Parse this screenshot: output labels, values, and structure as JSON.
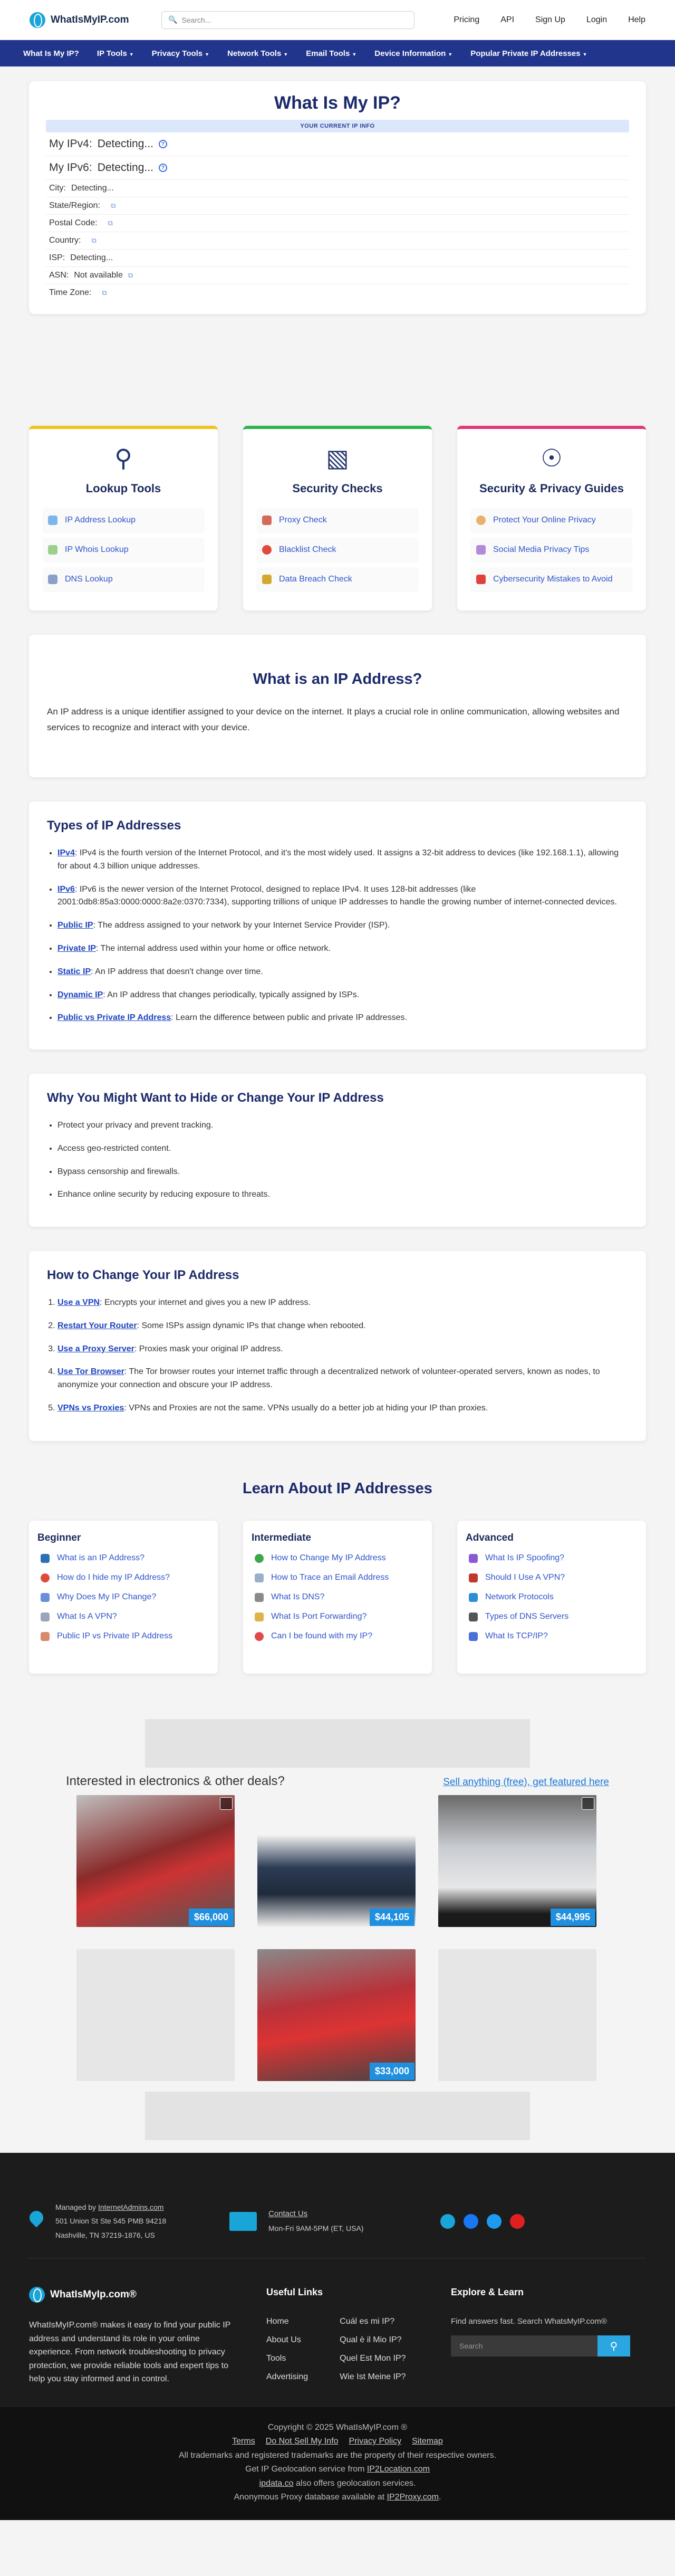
{
  "header": {
    "logo": "WhatIsMyIP.com",
    "search_placeholder": "Search...",
    "nav": [
      "Pricing",
      "API",
      "Sign Up",
      "Login",
      "Help"
    ]
  },
  "mainnav": [
    "What Is My IP?",
    "IP Tools",
    "Privacy Tools",
    "Network Tools",
    "Email Tools",
    "Device Information",
    "Popular Private IP Addresses"
  ],
  "ip_card": {
    "title": "What Is My IP?",
    "bar": "YOUR CURRENT IP INFO",
    "rows": [
      {
        "label": "My IPv4:",
        "value": "Detecting..."
      },
      {
        "label": "My IPv6:",
        "value": "Detecting..."
      },
      {
        "label": "City:",
        "value": "Detecting..."
      },
      {
        "label": "State/Region:",
        "value": ""
      },
      {
        "label": "Postal Code:",
        "value": ""
      },
      {
        "label": "Country:",
        "value": ""
      },
      {
        "label": "ISP:",
        "value": "Detecting..."
      },
      {
        "label": "ASN:",
        "value": "Not available"
      },
      {
        "label": "Time Zone:",
        "value": ""
      }
    ]
  },
  "tools": [
    {
      "title": "Lookup Tools",
      "color": "#f0c419",
      "items": [
        "IP Address Lookup",
        "IP Whois Lookup",
        "DNS Lookup"
      ]
    },
    {
      "title": "Security Checks",
      "color": "#2db34a",
      "items": [
        "Proxy Check",
        "Blacklist Check",
        "Data Breach Check"
      ]
    },
    {
      "title": "Security & Privacy Guides",
      "color": "#e0367a",
      "items": [
        "Protect Your Online Privacy",
        "Social Media Privacy Tips",
        "Cybersecurity Mistakes to Avoid"
      ]
    }
  ],
  "what": {
    "title": "What is an IP Address?",
    "text": "An IP address is a unique identifier assigned to your device on the internet. It plays a crucial role in online communication, allowing websites and services to recognize and interact with your device."
  },
  "types": {
    "title": "Types of IP Addresses",
    "items": [
      {
        "term": "IPv4",
        "text": ": IPv4 is the fourth version of the Internet Protocol, and it's the most widely used. It assigns a 32-bit address to devices (like 192.168.1.1), allowing for about 4.3 billion unique addresses."
      },
      {
        "term": "IPv6",
        "text": ": IPv6 is the newer version of the Internet Protocol, designed to replace IPv4. It uses 128-bit addresses (like 2001:0db8:85a3:0000:0000:8a2e:0370:7334), supporting trillions of unique IP addresses to handle the growing number of internet-connected devices."
      },
      {
        "term": "Public IP",
        "text": ": The address assigned to your network by your Internet Service Provider (ISP)."
      },
      {
        "term": "Private IP",
        "text": ": The internal address used within your home or office network."
      },
      {
        "term": "Static IP",
        "text": ": An IP address that doesn't change over time."
      },
      {
        "term": "Dynamic IP",
        "text": ": An IP address that changes periodically, typically assigned by ISPs."
      },
      {
        "term": "Public vs Private IP Address",
        "text": ": Learn the difference between public and private IP addresses."
      }
    ]
  },
  "hide": {
    "title": "Why You Might Want to Hide or Change Your IP Address",
    "items": [
      "Protect your privacy and prevent tracking.",
      "Access geo-restricted content.",
      "Bypass censorship and firewalls.",
      "Enhance online security by reducing exposure to threats."
    ]
  },
  "how": {
    "title": "How to Change Your IP Address",
    "items": [
      {
        "term": "Use a VPN",
        "text": ": Encrypts your internet and gives you a new IP address."
      },
      {
        "term": "Restart Your Router",
        "text": ": Some ISPs assign dynamic IPs that change when rebooted."
      },
      {
        "term": "Use a Proxy Server",
        "text": ": Proxies mask your original IP address."
      },
      {
        "term": "Use Tor Browser",
        "text": ": The Tor browser routes your internet traffic through a decentralized network of volunteer-operated servers, known as nodes, to anonymize your connection and obscure your IP address."
      },
      {
        "term": "VPNs vs Proxies",
        "text": ": VPNs and Proxies are not the same. VPNs usually do a better job at hiding your IP than proxies."
      }
    ]
  },
  "learn": {
    "title": "Learn About IP Addresses",
    "cols": [
      {
        "title": "Beginner",
        "items": [
          "What is an IP Address?",
          "How do I hide my IP Address?",
          "Why Does My IP Change?",
          "What Is A VPN?",
          "Public IP vs Private IP Address"
        ]
      },
      {
        "title": "Intermediate",
        "items": [
          "How to Change My IP Address",
          "How to Trace an Email Address",
          "What Is DNS?",
          "What Is Port Forwarding?",
          "Can I be found with my IP?"
        ]
      },
      {
        "title": "Advanced",
        "items": [
          "What Is IP Spoofing?",
          "Should I Use A VPN?",
          "Network Protocols",
          "Types of DNS Servers",
          "What Is TCP/IP?"
        ]
      }
    ]
  },
  "deals": {
    "title": "Interested in electronics & other deals?",
    "link": "Sell anything (free), get featured here",
    "items": [
      {
        "price": "$66,000",
        "color": "#8a2b2b"
      },
      {
        "price": "$44,105",
        "color": "#2c3c55"
      },
      {
        "price": "$44,995",
        "color": "#c9ccd1"
      },
      {
        "price": "",
        "color": "#e6e6e6"
      },
      {
        "price": "$33,000",
        "color": "#b8323a"
      },
      {
        "price": "",
        "color": "#e6e6e6"
      }
    ]
  },
  "footer": {
    "managed_prefix": "Managed by ",
    "managed_link": "InternetAdmins.com",
    "address1": "501 Union St Ste 545 PMB 94218",
    "address2": "Nashville, TN 37219-1876, US",
    "contact": "Contact Us",
    "hours": "Mon-Fri 9AM-5PM (ET, USA)",
    "brand": "WhatIsMyIp.com®",
    "about": "WhatIsMyIP.com® makes it easy to find your public IP address and understand its role in your online experience. From network troubleshooting to privacy protection, we provide reliable tools and expert tips to help you stay informed and in control.",
    "useful_title": "Useful Links",
    "useful_left": [
      "Home",
      "About Us",
      "Tools",
      "Advertising"
    ],
    "useful_right": [
      "Cuál es mi IP?",
      "Qual è il Mio IP?",
      "Quel Est Mon IP?",
      "Wie Ist Meine IP?"
    ],
    "explore_title": "Explore & Learn",
    "explore_text": "Find answers fast. Search WhatsMyIP.com®",
    "search_placeholder": "Search",
    "copyright": "Copyright © 2025 WhatIsMyIP.com ®",
    "bottom_links": [
      "Terms",
      "Do Not Sell My Info",
      "Privacy Policy",
      "Sitemap"
    ],
    "trademarks": "All trademarks and registered trademarks are the property of their respective owners.",
    "geo_prefix": "Get IP Geolocation service from ",
    "geo_link": "IP2Location.com",
    "ipdata_link": "ipdata.co",
    "ipdata_suffix": " also offers geolocation services.",
    "proxy_prefix": "Anonymous Proxy database available at ",
    "proxy_link": "IP2Proxy.com"
  }
}
